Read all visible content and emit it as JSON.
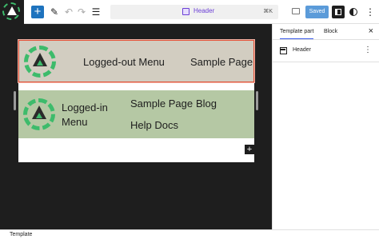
{
  "toolbar": {
    "add_label": "+",
    "command": {
      "label": "Header",
      "shortcut": "⌘K"
    },
    "saved_label": "Saved",
    "colors": {
      "accent": "#1e73be",
      "template_purple": "#6b3fd6"
    }
  },
  "canvas": {
    "logged_out_header": {
      "menu_name": "Logged-out Menu",
      "nav_items": [
        "Sample Page"
      ]
    },
    "logged_in_header": {
      "menu_name_line1": "Logged-in",
      "menu_name_line2": "Menu",
      "nav_items": [
        "Sample Page",
        "Blog",
        "Help Docs"
      ]
    },
    "add_block_label": "+"
  },
  "sidebar": {
    "tabs": [
      {
        "label": "Template part",
        "active": true
      },
      {
        "label": "Block",
        "active": false
      }
    ],
    "close_label": "×",
    "block": {
      "name": "Header"
    }
  },
  "footer": {
    "breadcrumb": "Template"
  },
  "icons": [
    "site-logo-icon",
    "add-icon",
    "pen-icon",
    "undo-icon",
    "redo-icon",
    "list-view-icon",
    "template-part-icon",
    "preview-icon",
    "settings-panel-icon",
    "styles-icon",
    "more-options-icon",
    "close-icon"
  ]
}
